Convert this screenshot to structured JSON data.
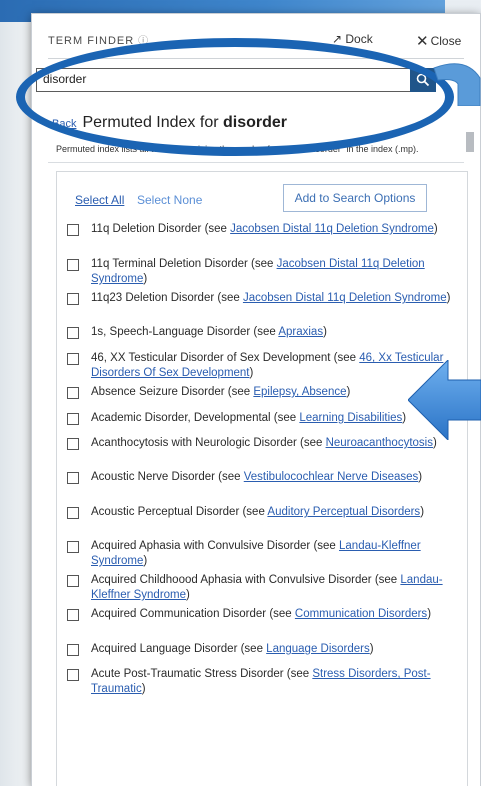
{
  "header": {
    "title": "TERM FINDER",
    "dock_label": "Dock",
    "close_label": "Close"
  },
  "search": {
    "value": "disorder",
    "placeholder": ""
  },
  "nav": {
    "back_label": "Back",
    "title_prefix": "Permuted Index for ",
    "title_term": "disorder"
  },
  "subtitle": "Permuted index lists all terms containing the word or fragment \"disorder\" in the index (.mp).",
  "actions": {
    "select_all": "Select All",
    "select_none": "Select None",
    "add_button": "Add to Search Options"
  },
  "items": [
    {
      "text": "11q Deletion Disorder (see ",
      "link": "Jacobsen Distal 11q Deletion Syndrome",
      "tail": ")"
    },
    {
      "text": "11q Terminal Deletion Disorder (see ",
      "link": "Jacobsen Distal 11q Deletion Syndrome",
      "tail": ")"
    },
    {
      "text": "11q23 Deletion Disorder (see ",
      "link": "Jacobsen Distal 11q Deletion Syndrome",
      "tail": ")"
    },
    {
      "text": "1s, Speech-Language Disorder (see ",
      "link": "Apraxias",
      "tail": ")"
    },
    {
      "text": "46, XX Testicular Disorder of Sex Development (see ",
      "link": "46, Xx Testicular Disorders Of Sex Development",
      "tail": ")"
    },
    {
      "text": "Absence Seizure Disorder (see ",
      "link": "Epilepsy, Absence",
      "tail": ")"
    },
    {
      "text": "Academic Disorder, Developmental (see ",
      "link": "Learning Disabilities",
      "tail": ")"
    },
    {
      "text": "Acanthocytosis with Neurologic Disorder (see ",
      "link": "Neuroacanthocytosis",
      "tail": ")"
    },
    {
      "text": "Acoustic Nerve Disorder (see ",
      "link": "Vestibulocochlear Nerve Diseases",
      "tail": ")"
    },
    {
      "text": "Acoustic Perceptual Disorder (see ",
      "link": "Auditory Perceptual Disorders",
      "tail": ")"
    },
    {
      "text": "Acquired Aphasia with Convulsive Disorder (see ",
      "link": "Landau-Kleffner Syndrome",
      "tail": ")"
    },
    {
      "text": "Acquired Childhoood Aphasia with Convulsive Disorder (see ",
      "link": "Landau-Kleffner Syndrome",
      "tail": ")"
    },
    {
      "text": "Acquired Communication Disorder (see ",
      "link": "Communication Disorders",
      "tail": ")"
    },
    {
      "text": "Acquired Language Disorder (see ",
      "link": "Language Disorders",
      "tail": ")"
    },
    {
      "text": "Acute Post-Traumatic Stress Disorder (see ",
      "link": "Stress Disorders, Post-Traumatic",
      "tail": ")"
    }
  ],
  "colors": {
    "accent": "#1b64b3",
    "link": "#2a5db0",
    "search_button": "#20558a"
  },
  "icons": {
    "search": "search-icon",
    "close": "close-icon",
    "dock": "dock-icon",
    "help": "help-icon"
  }
}
